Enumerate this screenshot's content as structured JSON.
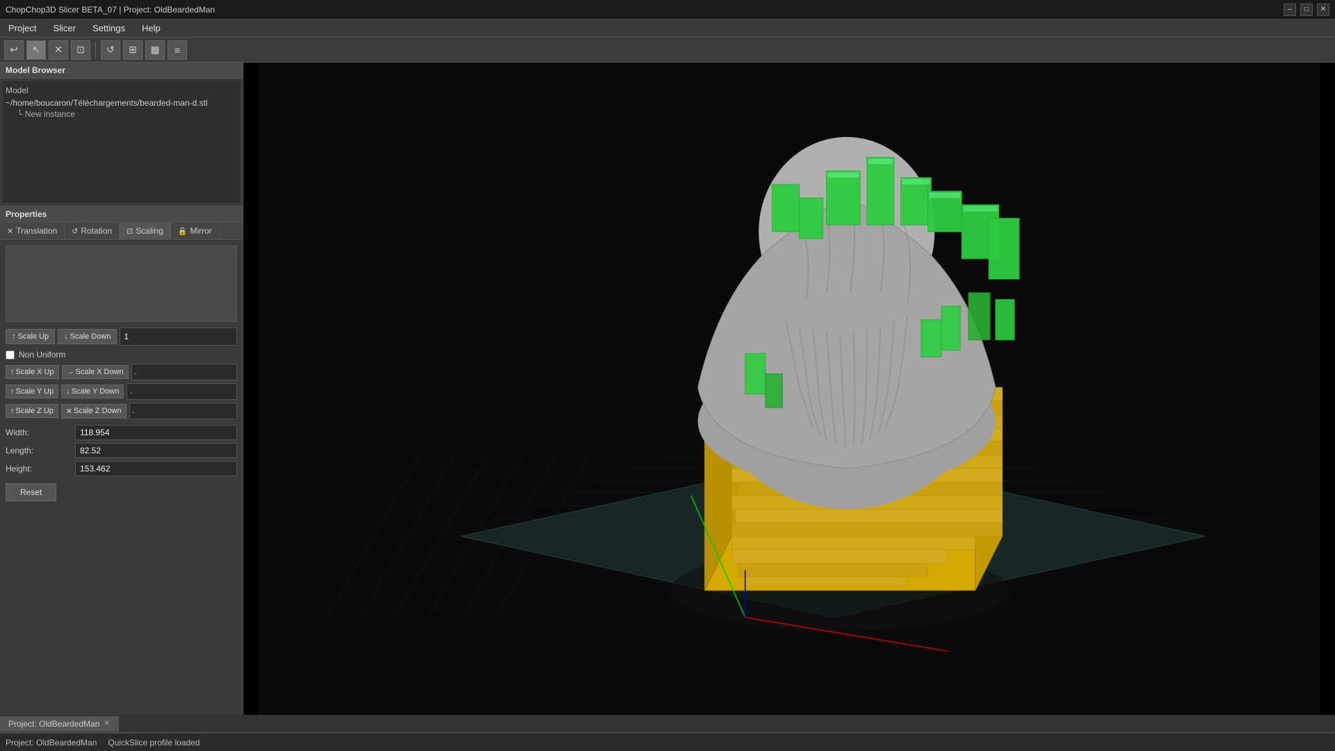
{
  "titleBar": {
    "title": "ChopChop3D Slicer BETA_07 | Project: OldBeardedMan",
    "controls": [
      "–",
      "□",
      "✕"
    ]
  },
  "menuBar": {
    "items": [
      "Project",
      "Slicer",
      "Settings",
      "Help"
    ]
  },
  "toolbar": {
    "buttons": [
      {
        "icon": "↩",
        "name": "undo"
      },
      {
        "icon": "↖",
        "name": "select"
      },
      {
        "icon": "✕",
        "name": "delete"
      },
      {
        "icon": "⊡",
        "name": "crop"
      },
      {
        "icon": "↺",
        "name": "rotate"
      },
      {
        "icon": "⊞",
        "name": "grid"
      },
      {
        "icon": "📊",
        "name": "chart"
      },
      {
        "icon": "≡",
        "name": "menu"
      }
    ]
  },
  "modelBrowser": {
    "title": "Model Browser",
    "treeLabel": "Model",
    "items": [
      {
        "label": "~/home/boucaron/Téléchargements/bearded-man-d.stl",
        "children": [
          {
            "label": "└ New instance"
          }
        ]
      }
    ]
  },
  "properties": {
    "title": "Properties",
    "tabs": [
      {
        "label": "Translation",
        "icon": "✕",
        "active": false
      },
      {
        "label": "Rotation",
        "icon": "↺",
        "active": false
      },
      {
        "label": "Scaling",
        "icon": "⊡",
        "active": true
      },
      {
        "label": "Mirror",
        "icon": "🔒",
        "active": false
      }
    ],
    "scaling": {
      "scaleUpLabel": "Scale Up",
      "scaleDownLabel": "Scale Down",
      "scaleValue": "1",
      "nonUniform": {
        "label": "Non Uniform",
        "checked": false,
        "xUp": "Scale X Up",
        "xDown": "Scale X Down",
        "xVal": ".",
        "yUp": "Scale Y Up",
        "yDown": "Scale Y Down",
        "yVal": ".",
        "zUp": "Scale Z Up",
        "zDown": "Scale Z Down",
        "zVal": "."
      },
      "dimensions": {
        "widthLabel": "Width:",
        "widthValue": "118.954",
        "lengthLabel": "Length:",
        "lengthValue": "82.52",
        "heightLabel": "Height:",
        "heightValue": "153.462"
      },
      "resetLabel": "Reset"
    }
  },
  "tabs": [
    {
      "label": "Project: OldBeardedMan",
      "active": true,
      "closable": true
    }
  ],
  "statusBar": {
    "projectText": "Project: OldBeardedMan",
    "statusText": "QuickSlice profile loaded"
  }
}
